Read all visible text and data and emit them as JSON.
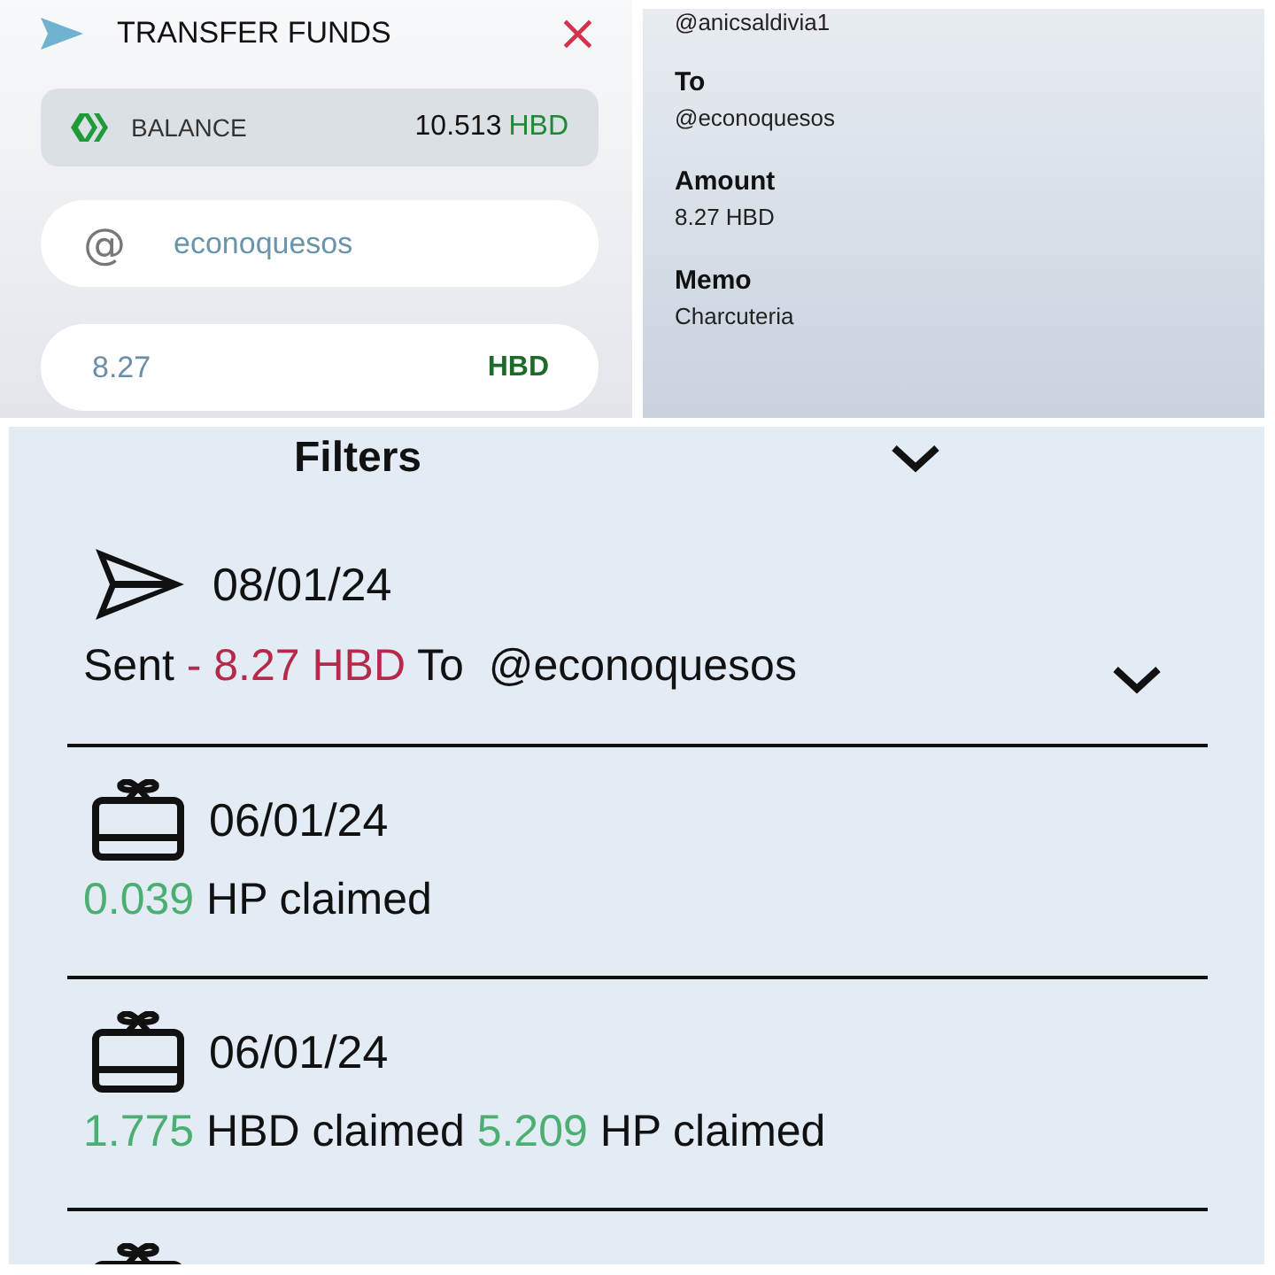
{
  "transfer_dialog": {
    "title": "TRANSFER FUNDS",
    "close": "×",
    "balance": {
      "label": "BALANCE",
      "amount": "10.513",
      "currency": "HBD"
    },
    "recipient_field": {
      "prefix": "@",
      "value": "econoquesos"
    },
    "amount_field": {
      "value": "8.27",
      "currency": "HBD"
    }
  },
  "confirmation": {
    "from_value": "@anicsaldivia1",
    "fields": [
      {
        "label": "To",
        "value": "@econoquesos"
      },
      {
        "label": "Amount",
        "value": "8.27 HBD"
      },
      {
        "label": "Memo",
        "value": "Charcuteria"
      }
    ]
  },
  "history": {
    "filters_label": "Filters",
    "filters_expanded": false,
    "transactions": [
      {
        "kind": "sent",
        "date": "08/01/24",
        "expandable": true,
        "segments": [
          {
            "text": "Sent ",
            "color": "#111111"
          },
          {
            "text": "- 8.27 HBD",
            "color": "#b5294a"
          },
          {
            "text": " To  @econoquesos",
            "color": "#111111"
          }
        ]
      },
      {
        "kind": "claim",
        "date": "06/01/24",
        "expandable": false,
        "segments": [
          {
            "text": "0.039",
            "color": "#4caf72"
          },
          {
            "text": " HP claimed",
            "color": "#111111"
          }
        ]
      },
      {
        "kind": "claim",
        "date": "06/01/24",
        "expandable": false,
        "segments": [
          {
            "text": "1.775",
            "color": "#4caf72"
          },
          {
            "text": " HBD claimed ",
            "color": "#111111"
          },
          {
            "text": "5.209",
            "color": "#4caf72"
          },
          {
            "text": " HP claimed",
            "color": "#111111"
          }
        ]
      },
      {
        "kind": "claim"
      }
    ]
  }
}
